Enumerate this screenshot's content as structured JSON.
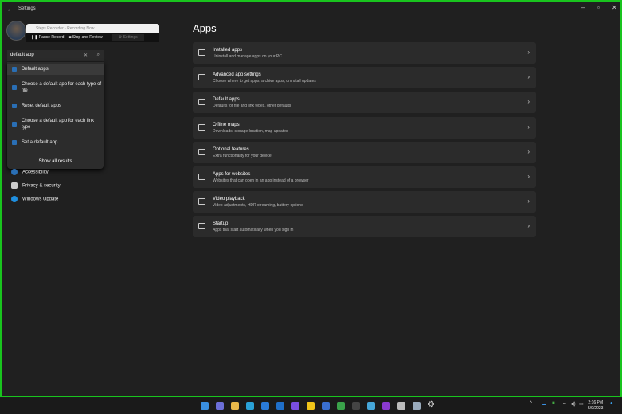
{
  "window": {
    "title": "Settings"
  },
  "steps_recorder": {
    "title": "Steps Recorder - Recording Now",
    "pause": "Pause Record",
    "stop": "Stop and Review",
    "settings": "Settings"
  },
  "search": {
    "value": "default app"
  },
  "results": [
    "Default apps",
    "Choose a default app for each type of file",
    "Reset default apps",
    "Choose a default app for each link type",
    "Set a default app"
  ],
  "show_all": "Show all results",
  "nav": [
    "Accessibility",
    "Privacy & security",
    "Windows Update"
  ],
  "page_title": "Apps",
  "cards": [
    {
      "title": "Installed apps",
      "sub": "Uninstall and manage apps on your PC"
    },
    {
      "title": "Advanced app settings",
      "sub": "Choose where to get apps, archive apps, uninstall updates"
    },
    {
      "title": "Default apps",
      "sub": "Defaults for file and link types, other defaults"
    },
    {
      "title": "Offline maps",
      "sub": "Downloads, storage location, map updates"
    },
    {
      "title": "Optional features",
      "sub": "Extra functionality for your device"
    },
    {
      "title": "Apps for websites",
      "sub": "Websites that can open in an app instead of a browser"
    },
    {
      "title": "Video playback",
      "sub": "Video adjustments, HDR streaming, battery options"
    },
    {
      "title": "Startup",
      "sub": "Apps that start automatically when you sign in"
    }
  ],
  "taskbar": {
    "time": "2:16 PM",
    "date": "5/9/2023",
    "colors": [
      "#3a8fe0",
      "#6b6ed8",
      "#e8b84a",
      "#2aa2d8",
      "#2a7ad8",
      "#1f6fc9",
      "#7a4ee0",
      "#f0c419",
      "#3a6fd0",
      "#3aa24a",
      "#444",
      "#46a6d8",
      "#8a3ad0",
      "#bbb",
      "#9ab"
    ]
  }
}
